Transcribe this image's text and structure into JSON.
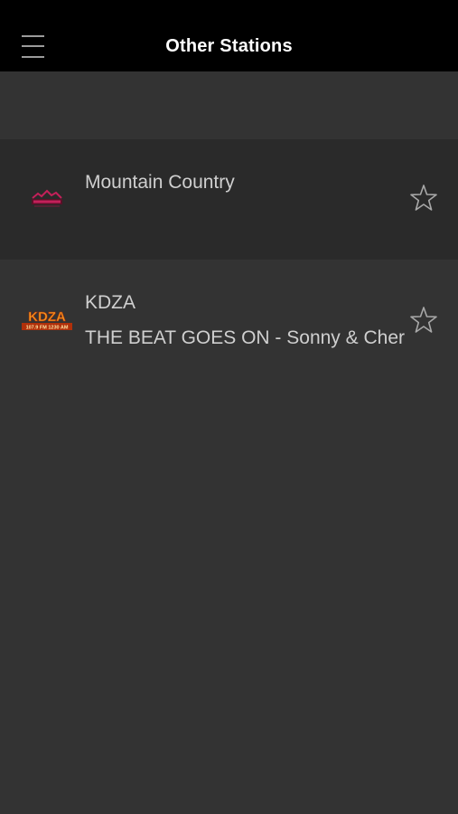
{
  "header": {
    "title": "Other Stations",
    "menu_icon": "hamburger-menu-icon"
  },
  "stations": [
    {
      "name": "Mountain Country",
      "now_playing": "",
      "logo_text": "MOUNTAIN",
      "logo_color": "#c4205a",
      "favorite_icon": "star-outline-icon"
    },
    {
      "name": "KDZA",
      "now_playing": "THE BEAT GOES ON - Sonny & Cher",
      "logo_text": "KDZA",
      "logo_subtext": "107.9 FM 1230 AM",
      "logo_color": "#f29a1f",
      "favorite_icon": "star-outline-icon"
    }
  ],
  "colors": {
    "topbar": "#000000",
    "background": "#333333",
    "row_highlight": "#2a2a2a",
    "text": "#cfcfcf",
    "icon": "#9b9b9b"
  }
}
